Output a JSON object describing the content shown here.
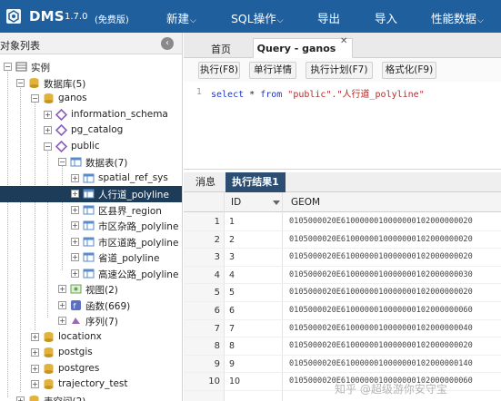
{
  "app": {
    "title": "DMS",
    "version": "1.7.0",
    "edition": "(免费版)",
    "brand_color": "#1f5f9e"
  },
  "menu": [
    {
      "label": "新建",
      "has_dropdown": true
    },
    {
      "label": "SQL操作",
      "has_dropdown": true
    },
    {
      "label": "导出",
      "has_dropdown": false
    },
    {
      "label": "导入",
      "has_dropdown": false
    },
    {
      "label": "性能数据",
      "has_dropdown": true
    }
  ],
  "sidebar": {
    "title": "对象列表",
    "collapse_icon": "chevron-left-icon",
    "tree": [
      {
        "label": "实例",
        "icon": "instance-icon",
        "toggle": "−"
      },
      {
        "label": "数据库(5)",
        "icon": "database-icon",
        "toggle": "−"
      },
      {
        "label": "ganos",
        "icon": "folder-icon",
        "toggle": "−"
      },
      {
        "label": "information_schema",
        "icon": "schema-icon",
        "toggle": "+"
      },
      {
        "label": "pg_catalog",
        "icon": "schema-icon",
        "toggle": "+"
      },
      {
        "label": "public",
        "icon": "schema-icon",
        "toggle": "−"
      },
      {
        "label": "数据表(7)",
        "icon": "tables-icon",
        "toggle": "−"
      },
      {
        "label": "spatial_ref_sys",
        "icon": "table-icon",
        "toggle": "+"
      },
      {
        "label": "人行道_polyline",
        "icon": "table-icon",
        "toggle": "+",
        "selected": true
      },
      {
        "label": "区县界_region",
        "icon": "table-icon",
        "toggle": "+"
      },
      {
        "label": "市区杂路_polyline",
        "icon": "table-icon",
        "toggle": "+"
      },
      {
        "label": "市区道路_polyline",
        "icon": "table-icon",
        "toggle": "+"
      },
      {
        "label": "省道_polyline",
        "icon": "table-icon",
        "toggle": "+"
      },
      {
        "label": "高速公路_polyline",
        "icon": "table-icon",
        "toggle": "+"
      },
      {
        "label": "视图(2)",
        "icon": "view-icon",
        "toggle": "+"
      },
      {
        "label": "函数(669)",
        "icon": "function-icon",
        "toggle": "+"
      },
      {
        "label": "序列(7)",
        "icon": "sequence-icon",
        "toggle": "+"
      },
      {
        "label": "locationx",
        "icon": "database-icon",
        "toggle": "+"
      },
      {
        "label": "postgis",
        "icon": "database-icon",
        "toggle": "+"
      },
      {
        "label": "postgres",
        "icon": "database-icon",
        "toggle": "+"
      },
      {
        "label": "trajectory_test",
        "icon": "database-icon",
        "toggle": "+"
      },
      {
        "label": "表空间(2)",
        "icon": "tablespace-icon",
        "toggle": "+"
      }
    ]
  },
  "tabs": [
    {
      "label": "首页",
      "active": false
    },
    {
      "label": "Query - ganos",
      "active": true,
      "closable": true
    }
  ],
  "toolbar": {
    "buttons": [
      "执行(F8)",
      "单行详情",
      "执行计划(F7)",
      "格式化(F9)"
    ]
  },
  "editor": {
    "line_number": "1",
    "keyword_select": "select",
    "star": " * ",
    "keyword_from": "from",
    "table_ref": " \"public\".\"人行道_polyline\""
  },
  "results": {
    "tabs": [
      {
        "label": "消息",
        "active": false
      },
      {
        "label": "执行结果1",
        "active": true
      }
    ],
    "columns": [
      "ID",
      "GEOM"
    ],
    "rows": [
      {
        "n": "1",
        "id": "1",
        "geom": "0105000020E6100000010000000102000000020"
      },
      {
        "n": "2",
        "id": "2",
        "geom": "0105000020E6100000010000000102000000020"
      },
      {
        "n": "3",
        "id": "3",
        "geom": "0105000020E6100000010000000102000000020"
      },
      {
        "n": "4",
        "id": "4",
        "geom": "0105000020E6100000010000000102000000030"
      },
      {
        "n": "5",
        "id": "5",
        "geom": "0105000020E6100000010000000102000000020"
      },
      {
        "n": "6",
        "id": "6",
        "geom": "0105000020E6100000010000000102000000060"
      },
      {
        "n": "7",
        "id": "7",
        "geom": "0105000020E6100000010000000102000000040"
      },
      {
        "n": "8",
        "id": "8",
        "geom": "0105000020E6100000010000000102000000020"
      },
      {
        "n": "9",
        "id": "9",
        "geom": "0105000020E6100000010000000102000000140"
      },
      {
        "n": "10",
        "id": "10",
        "geom": "0105000020E6100000010000000102000000060"
      }
    ]
  },
  "watermark": "知乎 @超级游你安守宝"
}
